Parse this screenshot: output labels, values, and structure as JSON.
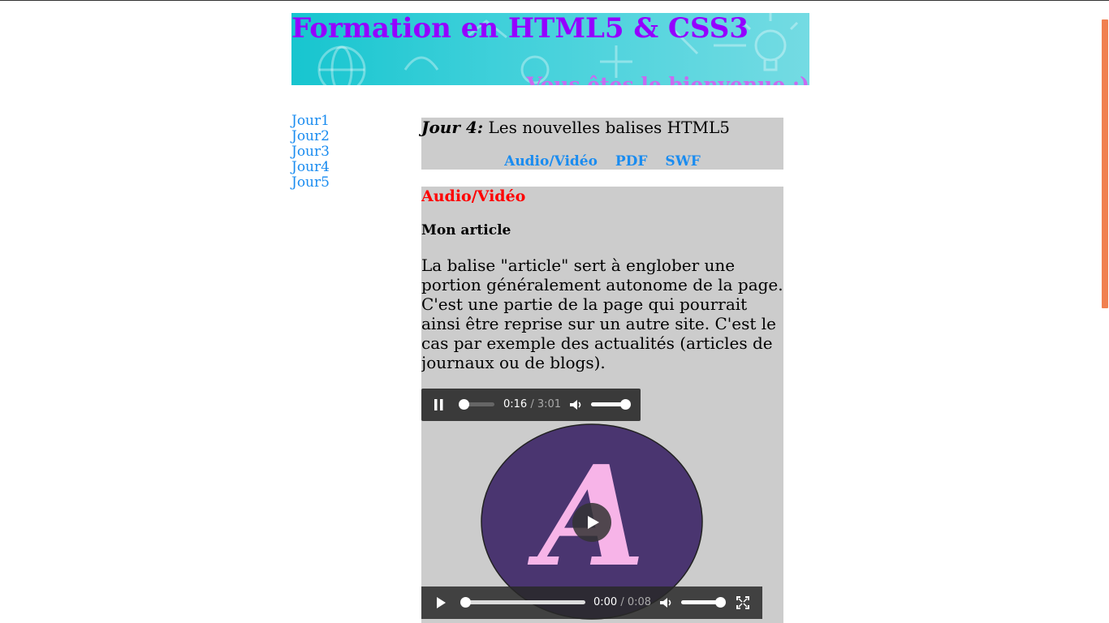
{
  "colors": {
    "title": "#9400ff",
    "subtitle": "#c86af0",
    "link": "#1a8cf0",
    "section_red": "#ff0000",
    "panel_gray": "#cccccc",
    "player_dark": "#3a3a3a"
  },
  "banner": {
    "title": "Formation en HTML5 & CSS3",
    "subtitle": "Vous êtes le bienvenue :)"
  },
  "nav": {
    "items": [
      {
        "label": "Jour1"
      },
      {
        "label": "Jour2"
      },
      {
        "label": "Jour3"
      },
      {
        "label": "Jour4"
      },
      {
        "label": "Jour5"
      }
    ]
  },
  "header": {
    "day_label": "Jour 4:",
    "day_topic": "Les nouvelles balises HTML5",
    "links": [
      {
        "label": "Audio/Vidéo"
      },
      {
        "label": "PDF"
      },
      {
        "label": "SWF"
      }
    ]
  },
  "article": {
    "section_title": "Audio/Vidéo",
    "title": "Mon article",
    "text": "La balise \"article\" sert à englober une portion généralement autonome de la page. C'est une partie de la page qui pourrait ainsi être reprise sur un autre site. C'est le cas par exemple des actualités (articles de journaux ou de blogs)."
  },
  "audio_player": {
    "current_time": "0:16",
    "separator": "/",
    "duration": "3:01",
    "progress": 0.09,
    "volume": 1.0,
    "state": "playing",
    "icons": [
      "pause-icon",
      "volume-icon"
    ]
  },
  "video_player": {
    "current_time": "0:00",
    "separator": "/",
    "duration": "0:08",
    "progress": 0.0,
    "volume": 1.0,
    "state": "paused",
    "poster_letter": "A",
    "icons": [
      "play-icon",
      "volume-icon",
      "fullscreen-icon",
      "big-play-icon"
    ]
  }
}
